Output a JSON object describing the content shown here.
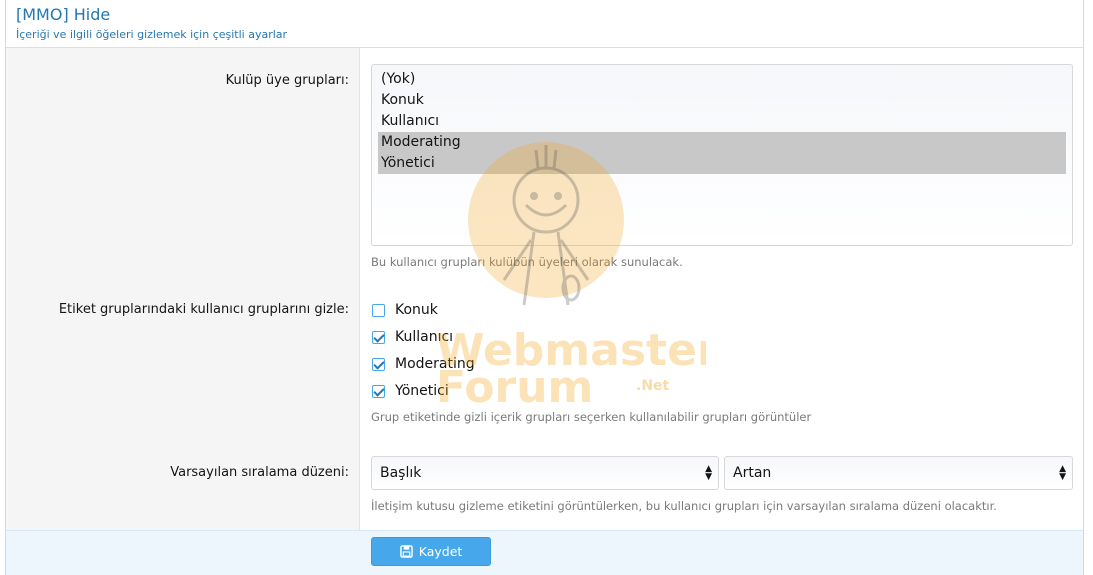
{
  "header": {
    "title": "[MMO] Hide",
    "description": "İçeriği ve ilgili öğeleri gizlemek için çeşitli ayarlar"
  },
  "club_groups": {
    "label": "Kulüp üye grupları:",
    "options": [
      {
        "label": "(Yok)",
        "selected": false
      },
      {
        "label": "Konuk",
        "selected": false
      },
      {
        "label": "Kullanıcı",
        "selected": false
      },
      {
        "label": "Moderating",
        "selected": true
      },
      {
        "label": "Yönetici",
        "selected": true
      }
    ],
    "hint": "Bu kullanıcı grupları kulübün üyeleri olarak sunulacak."
  },
  "hide_groups": {
    "label": "Etiket gruplarındaki kullanıcı gruplarını gizle:",
    "options": [
      {
        "label": "Konuk",
        "checked": false
      },
      {
        "label": "Kullanıcı",
        "checked": true
      },
      {
        "label": "Moderating",
        "checked": true
      },
      {
        "label": "Yönetici",
        "checked": true
      }
    ],
    "hint": "Grup etiketinde gizli içerik grupları seçerken kullanılabilir grupları görüntüler"
  },
  "sort_order": {
    "label": "Varsayılan sıralama düzeni:",
    "field": "Başlık",
    "direction": "Artan",
    "hint": "İletişim kutusu gizleme etiketini görüntülerken, bu kullanıcı grupları için varsayılan sıralama düzeni olacaktır."
  },
  "footer": {
    "save_label": "Kaydet"
  },
  "watermark": {
    "line1": "Webmaster",
    "line2": "Forum",
    "badge": ".Net"
  },
  "colors": {
    "accent": "#47a7eb",
    "link": "#2577b1",
    "watermark": "#f5a623"
  }
}
